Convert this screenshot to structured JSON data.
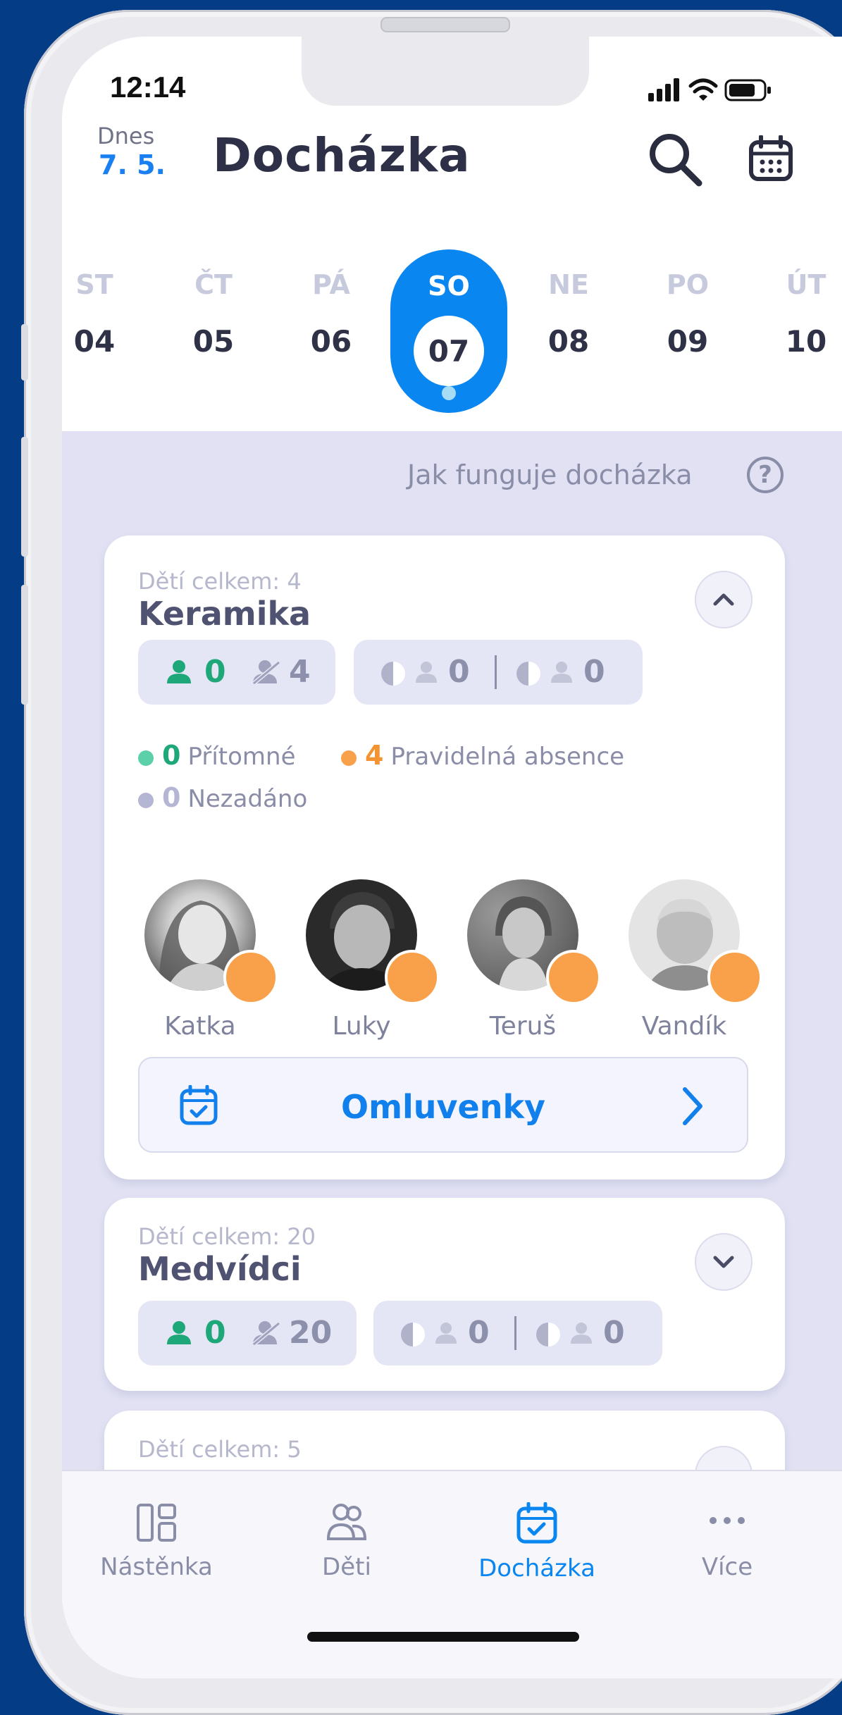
{
  "status_bar": {
    "time": "12:14"
  },
  "header": {
    "today_label": "Dnes",
    "today_date": "7. 5.",
    "title": "Docházka"
  },
  "days": [
    {
      "dow": "ST",
      "num": "04"
    },
    {
      "dow": "ČT",
      "num": "05"
    },
    {
      "dow": "PÁ",
      "num": "06"
    },
    {
      "dow": "SO",
      "num": "07",
      "selected": true
    },
    {
      "dow": "NE",
      "num": "08"
    },
    {
      "dow": "PO",
      "num": "09"
    },
    {
      "dow": "ÚT",
      "num": "10"
    }
  ],
  "help": {
    "label": "Jak funguje docházka",
    "icon": "?"
  },
  "groups": [
    {
      "count_label": "Dětí celkem: 4",
      "name": "Keramika",
      "expanded": true,
      "present": "0",
      "absent": "4",
      "half_a": "0",
      "half_b": "0",
      "legend": {
        "present_count": "0",
        "present_label": "Přítomné",
        "regular_count": "4",
        "regular_label": "Pravidelná absence",
        "unset_count": "0",
        "unset_label": "Nezadáno"
      },
      "children": [
        {
          "name": "Katka"
        },
        {
          "name": "Luky"
        },
        {
          "name": "Teruš"
        },
        {
          "name": "Vandík"
        }
      ],
      "action_label": "Omluvenky"
    },
    {
      "count_label": "Dětí celkem: 20",
      "name": "Medvídci",
      "expanded": false,
      "present": "0",
      "absent": "20",
      "half_a": "0",
      "half_b": "0"
    },
    {
      "count_label": "Dětí celkem: 5"
    }
  ],
  "tabs": [
    {
      "label": "Nástěnka",
      "icon": "dashboard-icon"
    },
    {
      "label": "Děti",
      "icon": "children-icon"
    },
    {
      "label": "Docházka",
      "icon": "calendar-check-icon",
      "active": true
    },
    {
      "label": "Více",
      "icon": "more-icon"
    }
  ],
  "colors": {
    "accent": "#0a86f0",
    "present": "#1ea779",
    "absence": "#f8a14a",
    "unset": "#b4b6d4",
    "background": "#e1e1f3"
  }
}
